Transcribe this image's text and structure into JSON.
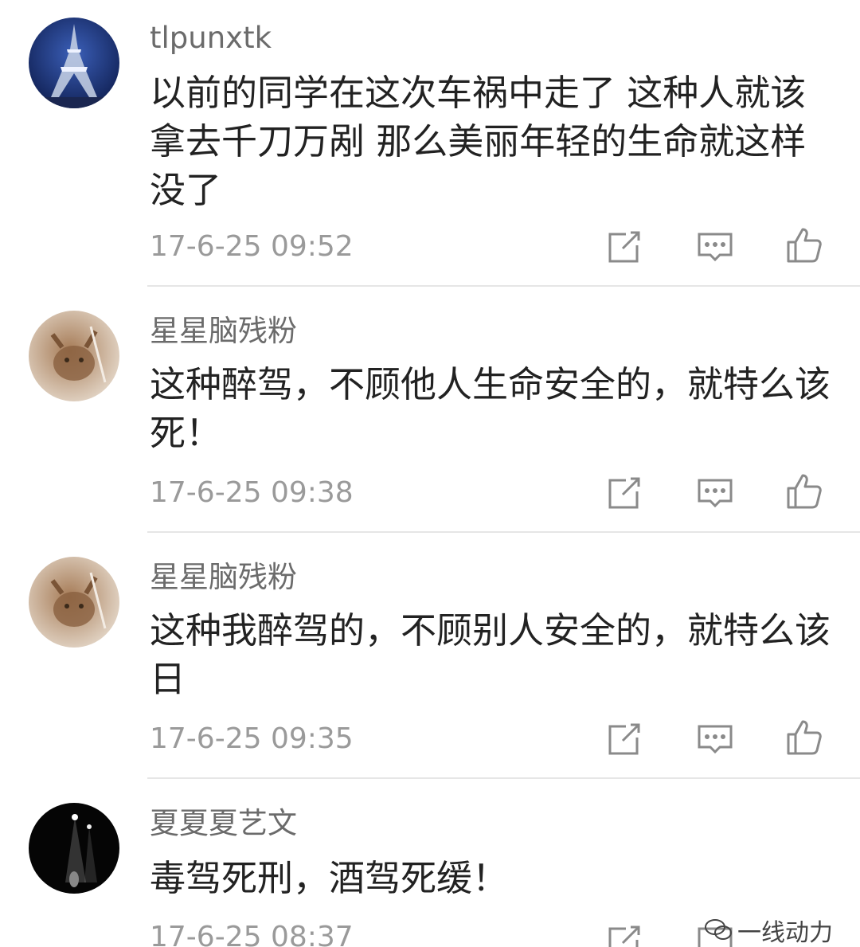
{
  "comments": [
    {
      "username": "tlpunxtk",
      "text": "以前的同学在这次车祸中走了 这种人就该拿去千刀万剐 那么美丽年轻的生命就这样没了",
      "time": "17-6-25 09:52",
      "avatar": "eiffel-tower-night"
    },
    {
      "username": "星星脑残粉",
      "text": "这种醉驾，不顾他人生命安全的，就特么该死！",
      "time": "17-6-25 09:38",
      "avatar": "cat-photo"
    },
    {
      "username": "星星脑残粉",
      "text": "这种我醉驾的，不顾别人安全的，就特么该日",
      "time": "17-6-25 09:35",
      "avatar": "cat-photo"
    },
    {
      "username": "夏夏夏艺文",
      "text": "毒驾死刑，酒驾死缓！",
      "time": "17-6-25 08:37",
      "avatar": "stage-spotlight"
    }
  ],
  "actions": {
    "share": "share-icon",
    "reply": "comment-icon",
    "like": "thumbs-up-icon"
  },
  "watermark": {
    "text": "一线动力",
    "icon": "wechat-icon"
  },
  "colors": {
    "username": "#6b6b6b",
    "text": "#222222",
    "time": "#9a9a9a",
    "divider": "#e6e6e6",
    "icon": "#8a8a8a"
  }
}
